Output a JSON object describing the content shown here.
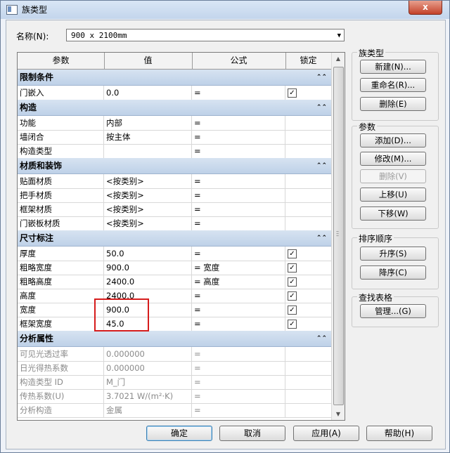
{
  "window": {
    "title": "族类型",
    "close_label": "x"
  },
  "name_row": {
    "label": "名称(N):",
    "value": "900 x 2100mm"
  },
  "grid": {
    "headers": [
      "参数",
      "值",
      "公式",
      "锁定"
    ],
    "groups": [
      {
        "title": "限制条件",
        "rows": [
          {
            "param": "门嵌入",
            "value": "0.0",
            "formula": "=",
            "lock": true
          }
        ]
      },
      {
        "title": "构造",
        "rows": [
          {
            "param": "功能",
            "value": "内部",
            "formula": "=",
            "lock": null
          },
          {
            "param": "墙闭合",
            "value": "按主体",
            "formula": "=",
            "lock": null
          },
          {
            "param": "构造类型",
            "value": "",
            "formula": "=",
            "lock": null
          }
        ]
      },
      {
        "title": "材质和装饰",
        "rows": [
          {
            "param": "贴面材质",
            "value": "<按类别>",
            "formula": "=",
            "lock": null
          },
          {
            "param": "把手材质",
            "value": "<按类别>",
            "formula": "=",
            "lock": null
          },
          {
            "param": "框架材质",
            "value": "<按类别>",
            "formula": "=",
            "lock": null
          },
          {
            "param": "门嵌板材质",
            "value": "<按类别>",
            "formula": "=",
            "lock": null
          }
        ]
      },
      {
        "title": "尺寸标注",
        "rows": [
          {
            "param": "厚度",
            "value": "50.0",
            "formula": "=",
            "lock": true
          },
          {
            "param": "粗略宽度",
            "value": "900.0",
            "formula": "= 宽度",
            "lock": true
          },
          {
            "param": "粗略高度",
            "value": "2400.0",
            "formula": "= 高度",
            "lock": true
          },
          {
            "param": "高度",
            "value": "2400.0",
            "formula": "=",
            "lock": true
          },
          {
            "param": "宽度",
            "value": "900.0",
            "formula": "=",
            "lock": true
          },
          {
            "param": "框架宽度",
            "value": "45.0",
            "formula": "=",
            "lock": true
          }
        ]
      },
      {
        "title": "分析属性",
        "grey": true,
        "rows": [
          {
            "param": "可见光透过率",
            "value": "0.000000",
            "formula": "=",
            "lock": null
          },
          {
            "param": "日光得热系数",
            "value": "0.000000",
            "formula": "=",
            "lock": null
          },
          {
            "param": "构造类型 ID",
            "value": "M_门",
            "formula": "=",
            "lock": null
          },
          {
            "param": "传热系数(U)",
            "value": "3.7021 W/(m²·K)",
            "formula": "=",
            "lock": null
          },
          {
            "param": "分析构造",
            "value": "金属",
            "formula": "=",
            "lock": null
          }
        ]
      }
    ],
    "collapse_icon": "chevron-double-up-icon"
  },
  "side": {
    "family_types": {
      "title": "族类型",
      "new": "新建(N)...",
      "rename": "重命名(R)...",
      "delete": "删除(E)"
    },
    "params": {
      "title": "参数",
      "add": "添加(D)...",
      "modify": "修改(M)...",
      "delete": "删除(V)",
      "move_up": "上移(U)",
      "move_down": "下移(W)"
    },
    "sort": {
      "title": "排序顺序",
      "asc": "升序(S)",
      "desc": "降序(C)"
    },
    "lookup": {
      "title": "查找表格",
      "manage": "管理...(G)"
    }
  },
  "footer": {
    "ok": "确定",
    "cancel": "取消",
    "apply": "应用(A)",
    "help": "帮助(H)"
  },
  "colors": {
    "group_header": "#c8d8ec",
    "highlight_box": "#d61c1c"
  }
}
